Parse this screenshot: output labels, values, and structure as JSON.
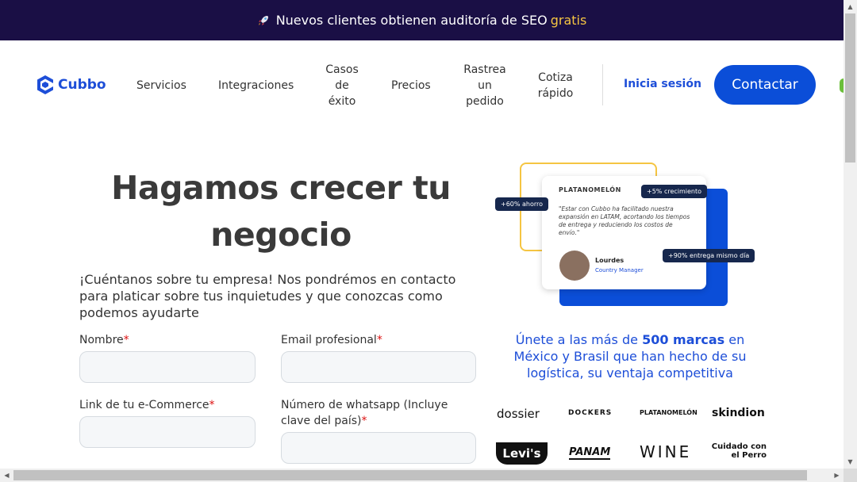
{
  "banner": {
    "text": "Nuevos clientes obtienen auditoría de SEO",
    "highlight": "gratis",
    "highlight_color": "#f5c542",
    "background": "#1a0f45"
  },
  "nav": {
    "logo_text": "Cubbo",
    "items": [
      "Servicios",
      "Integraciones",
      "Casos de éxito",
      "Precios",
      "Rastrea un pedido",
      "Cotiza rápido"
    ],
    "login": "Inicia sesión",
    "contact": "Contactar",
    "accent": "#0b4ed8"
  },
  "hero": {
    "title": "Hagamos crecer tu negocio",
    "subtitle": "¡Cuéntanos sobre tu empresa! Nos pondrémos en contacto para platicar sobre tus inquietudes y que conozcas como podemos ayudarte"
  },
  "form": {
    "name_label": "Nombre",
    "email_label": "Email profesional",
    "ecommerce_label": "Link de tu e-Commerce",
    "whatsapp_label": "Número de whatsapp (Incluye clave del país)",
    "required_mark": "*"
  },
  "testimonial": {
    "brand": "PLATANOMELÓN",
    "quote": "\"Estar con Cubbo ha facilitado nuestra expansión en LATAM, acortando los tiempos de entrega y reduciendo los costos de envío.\"",
    "name": "Lourdes",
    "role": "Country Manager",
    "pill_savings": "+60% ahorro",
    "pill_growth": "+5% crecimiento",
    "pill_delivery": "+90% entrega mismo día"
  },
  "join": {
    "prefix": "Únete a las más de ",
    "bold": "500 marcas",
    "suffix": " en México y Brasil que han hecho de su logística, su ventaja competitiva"
  },
  "brands": [
    "dossier",
    "DOCKERS",
    "PLATANOMELÓN",
    "skindion",
    "Levi's",
    "PANAM",
    "WINE",
    "Cuidado con el Perro"
  ]
}
